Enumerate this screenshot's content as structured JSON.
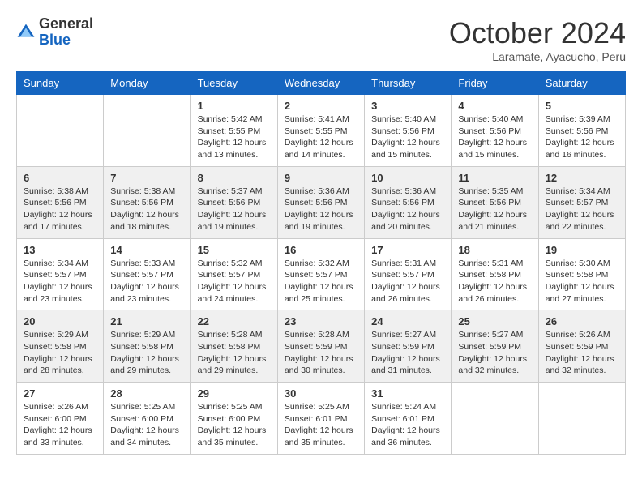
{
  "header": {
    "logo": {
      "line1": "General",
      "line2": "Blue"
    },
    "title": "October 2024",
    "subtitle": "Laramate, Ayacucho, Peru"
  },
  "days_of_week": [
    "Sunday",
    "Monday",
    "Tuesday",
    "Wednesday",
    "Thursday",
    "Friday",
    "Saturday"
  ],
  "weeks": [
    [
      {
        "day": "",
        "info": ""
      },
      {
        "day": "",
        "info": ""
      },
      {
        "day": "1",
        "sunrise": "Sunrise: 5:42 AM",
        "sunset": "Sunset: 5:55 PM",
        "daylight": "Daylight: 12 hours and 13 minutes."
      },
      {
        "day": "2",
        "sunrise": "Sunrise: 5:41 AM",
        "sunset": "Sunset: 5:55 PM",
        "daylight": "Daylight: 12 hours and 14 minutes."
      },
      {
        "day": "3",
        "sunrise": "Sunrise: 5:40 AM",
        "sunset": "Sunset: 5:56 PM",
        "daylight": "Daylight: 12 hours and 15 minutes."
      },
      {
        "day": "4",
        "sunrise": "Sunrise: 5:40 AM",
        "sunset": "Sunset: 5:56 PM",
        "daylight": "Daylight: 12 hours and 15 minutes."
      },
      {
        "day": "5",
        "sunrise": "Sunrise: 5:39 AM",
        "sunset": "Sunset: 5:56 PM",
        "daylight": "Daylight: 12 hours and 16 minutes."
      }
    ],
    [
      {
        "day": "6",
        "sunrise": "Sunrise: 5:38 AM",
        "sunset": "Sunset: 5:56 PM",
        "daylight": "Daylight: 12 hours and 17 minutes."
      },
      {
        "day": "7",
        "sunrise": "Sunrise: 5:38 AM",
        "sunset": "Sunset: 5:56 PM",
        "daylight": "Daylight: 12 hours and 18 minutes."
      },
      {
        "day": "8",
        "sunrise": "Sunrise: 5:37 AM",
        "sunset": "Sunset: 5:56 PM",
        "daylight": "Daylight: 12 hours and 19 minutes."
      },
      {
        "day": "9",
        "sunrise": "Sunrise: 5:36 AM",
        "sunset": "Sunset: 5:56 PM",
        "daylight": "Daylight: 12 hours and 19 minutes."
      },
      {
        "day": "10",
        "sunrise": "Sunrise: 5:36 AM",
        "sunset": "Sunset: 5:56 PM",
        "daylight": "Daylight: 12 hours and 20 minutes."
      },
      {
        "day": "11",
        "sunrise": "Sunrise: 5:35 AM",
        "sunset": "Sunset: 5:56 PM",
        "daylight": "Daylight: 12 hours and 21 minutes."
      },
      {
        "day": "12",
        "sunrise": "Sunrise: 5:34 AM",
        "sunset": "Sunset: 5:57 PM",
        "daylight": "Daylight: 12 hours and 22 minutes."
      }
    ],
    [
      {
        "day": "13",
        "sunrise": "Sunrise: 5:34 AM",
        "sunset": "Sunset: 5:57 PM",
        "daylight": "Daylight: 12 hours and 23 minutes."
      },
      {
        "day": "14",
        "sunrise": "Sunrise: 5:33 AM",
        "sunset": "Sunset: 5:57 PM",
        "daylight": "Daylight: 12 hours and 23 minutes."
      },
      {
        "day": "15",
        "sunrise": "Sunrise: 5:32 AM",
        "sunset": "Sunset: 5:57 PM",
        "daylight": "Daylight: 12 hours and 24 minutes."
      },
      {
        "day": "16",
        "sunrise": "Sunrise: 5:32 AM",
        "sunset": "Sunset: 5:57 PM",
        "daylight": "Daylight: 12 hours and 25 minutes."
      },
      {
        "day": "17",
        "sunrise": "Sunrise: 5:31 AM",
        "sunset": "Sunset: 5:57 PM",
        "daylight": "Daylight: 12 hours and 26 minutes."
      },
      {
        "day": "18",
        "sunrise": "Sunrise: 5:31 AM",
        "sunset": "Sunset: 5:58 PM",
        "daylight": "Daylight: 12 hours and 26 minutes."
      },
      {
        "day": "19",
        "sunrise": "Sunrise: 5:30 AM",
        "sunset": "Sunset: 5:58 PM",
        "daylight": "Daylight: 12 hours and 27 minutes."
      }
    ],
    [
      {
        "day": "20",
        "sunrise": "Sunrise: 5:29 AM",
        "sunset": "Sunset: 5:58 PM",
        "daylight": "Daylight: 12 hours and 28 minutes."
      },
      {
        "day": "21",
        "sunrise": "Sunrise: 5:29 AM",
        "sunset": "Sunset: 5:58 PM",
        "daylight": "Daylight: 12 hours and 29 minutes."
      },
      {
        "day": "22",
        "sunrise": "Sunrise: 5:28 AM",
        "sunset": "Sunset: 5:58 PM",
        "daylight": "Daylight: 12 hours and 29 minutes."
      },
      {
        "day": "23",
        "sunrise": "Sunrise: 5:28 AM",
        "sunset": "Sunset: 5:59 PM",
        "daylight": "Daylight: 12 hours and 30 minutes."
      },
      {
        "day": "24",
        "sunrise": "Sunrise: 5:27 AM",
        "sunset": "Sunset: 5:59 PM",
        "daylight": "Daylight: 12 hours and 31 minutes."
      },
      {
        "day": "25",
        "sunrise": "Sunrise: 5:27 AM",
        "sunset": "Sunset: 5:59 PM",
        "daylight": "Daylight: 12 hours and 32 minutes."
      },
      {
        "day": "26",
        "sunrise": "Sunrise: 5:26 AM",
        "sunset": "Sunset: 5:59 PM",
        "daylight": "Daylight: 12 hours and 32 minutes."
      }
    ],
    [
      {
        "day": "27",
        "sunrise": "Sunrise: 5:26 AM",
        "sunset": "Sunset: 6:00 PM",
        "daylight": "Daylight: 12 hours and 33 minutes."
      },
      {
        "day": "28",
        "sunrise": "Sunrise: 5:25 AM",
        "sunset": "Sunset: 6:00 PM",
        "daylight": "Daylight: 12 hours and 34 minutes."
      },
      {
        "day": "29",
        "sunrise": "Sunrise: 5:25 AM",
        "sunset": "Sunset: 6:00 PM",
        "daylight": "Daylight: 12 hours and 35 minutes."
      },
      {
        "day": "30",
        "sunrise": "Sunrise: 5:25 AM",
        "sunset": "Sunset: 6:01 PM",
        "daylight": "Daylight: 12 hours and 35 minutes."
      },
      {
        "day": "31",
        "sunrise": "Sunrise: 5:24 AM",
        "sunset": "Sunset: 6:01 PM",
        "daylight": "Daylight: 12 hours and 36 minutes."
      },
      {
        "day": "",
        "info": ""
      },
      {
        "day": "",
        "info": ""
      }
    ]
  ]
}
